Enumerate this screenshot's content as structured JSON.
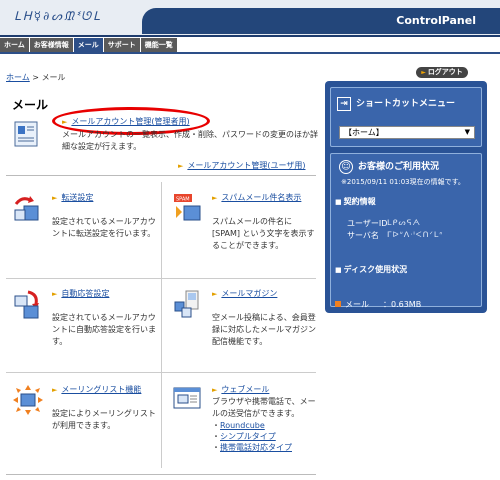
{
  "header": {
    "logo": "ᒪᕼ☿∂ᔕᙢᓫᘎᒪ",
    "title": "ControlPanel"
  },
  "tabs": [
    "ホーム",
    "お客様情報",
    "メール",
    "サポート",
    "機能一覧"
  ],
  "active_tab": "メール",
  "breadcrumb": {
    "home": "ホーム",
    "sep": " > ",
    "current": "メール"
  },
  "page_title": "メール",
  "mail_account_admin": {
    "link": "メールアカウント管理(管理者用)",
    "desc": "メールアカウントの一覧表示、作成・削除、パスワードの変更のほか詳細な設定が行えます。"
  },
  "mail_account_user": {
    "link": "メールアカウント管理(ユーザ用)"
  },
  "cells": [
    {
      "link": "転送設定",
      "desc": "設定されているメールアカウントに転送設定を行います。",
      "icon": "forward-icon"
    },
    {
      "link": "スパムメール件名表示",
      "desc": "スパムメールの件名に [SPAM] という文字を表示することができます。",
      "icon": "spam-icon"
    },
    {
      "link": "自動応答設定",
      "desc": "設定されているメールアカウントに自動応答設定を行います。",
      "icon": "autoreply-icon"
    },
    {
      "link": "メールマガジン",
      "desc": "空メール投稿による、会員登録に対応したメールマガジン配信機能です。",
      "icon": "magazine-icon"
    },
    {
      "link": "メーリングリスト機能",
      "desc": "設定によりメーリングリストが利用できます。",
      "icon": "mailing-list-icon"
    },
    {
      "link": "ウェブメール",
      "desc": "ブラウザや携帯電話で、メールの送受信ができます。",
      "icon": "webmail-icon",
      "sublinks": [
        "Roundcube",
        "シンプルタイプ",
        "携帯電話対応タイプ"
      ]
    }
  ],
  "sidebar": {
    "logout": "ログアウト",
    "shortcut_title": "ショートカットメニュー",
    "shortcut_selected": "【ホーム】",
    "status_title": "お客様のご利用状況",
    "status_time": "※2015/09/11 01:03現在の情報です。",
    "contract_head": "契約情報",
    "user_id_label": "ユーザーID",
    "user_id_value": "ᒪᑭᔕᕋᗅ",
    "server_label": "サーバ名",
    "server_value": "ᒥᐅᐡᐱᐧᑊᐸᑎᐟᒪᐢ",
    "disk_head": "ディスク使用状況",
    "disk_label": "メール",
    "disk_value": "：0.63MB"
  },
  "colors": {
    "nav": "#2d4f88",
    "sidebar": "#2a5396",
    "link": "#1a4ea0",
    "highlight": "#e80000"
  }
}
